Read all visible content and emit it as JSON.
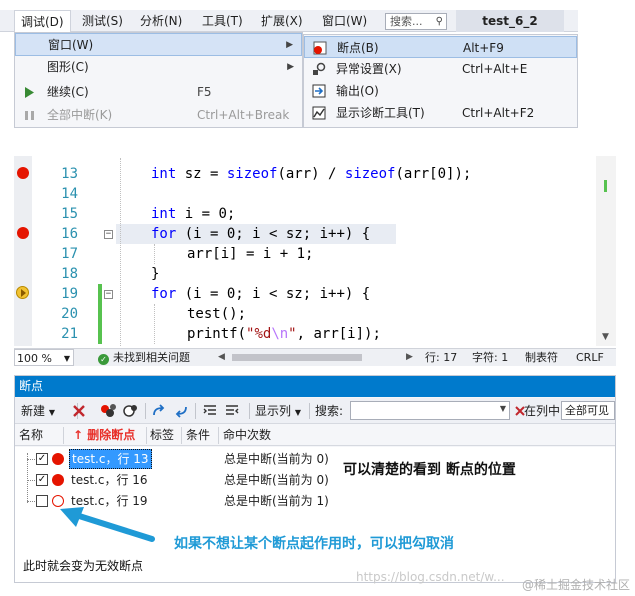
{
  "menubar": {
    "items": [
      "调试(D)",
      "测试(S)",
      "分析(N)",
      "工具(T)",
      "扩展(X)",
      "窗口(W)"
    ],
    "search_placeholder": "搜索...",
    "project_title": "test_6_2"
  },
  "debug_menu": {
    "items": [
      {
        "label": "窗口(W)",
        "shortcut": "",
        "submenu": true
      },
      {
        "label": "图形(C)",
        "shortcut": "",
        "submenu": true
      },
      {
        "label": "继续(C)",
        "shortcut": "F5"
      },
      {
        "label": "全部中断(K)",
        "shortcut": "Ctrl+Alt+Break"
      }
    ]
  },
  "windows_submenu": {
    "items": [
      {
        "label": "断点(B)",
        "shortcut": "Alt+F9"
      },
      {
        "label": "异常设置(X)",
        "shortcut": "Ctrl+Alt+E"
      },
      {
        "label": "输出(O)",
        "shortcut": ""
      },
      {
        "label": "显示诊断工具(T)",
        "shortcut": "Ctrl+Alt+F2"
      }
    ]
  },
  "editor": {
    "line_numbers": [
      "13",
      "14",
      "15",
      "16",
      "17",
      "18",
      "19",
      "20",
      "21"
    ],
    "zoom": "100 %",
    "issues": "未找到相关问题",
    "line_status": "行: 17",
    "char_status": "字符: 1",
    "tab_status": "制表符",
    "eol_status": "CRLF",
    "code": {
      "l13_type": "int",
      "l13_mid": " sz = ",
      "l13_fn1": "sizeof",
      "l13_args": "(arr) / ",
      "l13_fn2": "sizeof",
      "l13_end": "(arr[0]);",
      "l15_type": "int",
      "l15_rest": " i = 0;",
      "l16_kw": "for",
      "l16_rest": " (i = 0; i < sz; i++) {",
      "l17_text": "arr[i] = i + 1;",
      "l18_text": "}",
      "l19_kw": "for",
      "l19_rest": " (i = 0; i < sz; i++) {",
      "l20_text": "test();",
      "l21_fn": "printf(",
      "l21_str1": "\"%d",
      "l21_esc": "\\n",
      "l21_str2": "\"",
      "l21_end": ", arr[i]);"
    }
  },
  "breakpoints_window": {
    "title": "断点",
    "toolbar": {
      "new_label": "新建",
      "columns_label": "显示列",
      "search_label": "搜索:",
      "in_column_label": "在列中:",
      "scope_value": "全部可见"
    },
    "columns": {
      "name": "名称",
      "delete_note": "↑ 删除断点",
      "labels": "标签",
      "condition": "条件",
      "hit_count": "命中次数"
    },
    "rows": [
      {
        "checked": true,
        "enabled": true,
        "name": "test.c，行 13",
        "hit": "总是中断(当前为 0)"
      },
      {
        "checked": true,
        "enabled": true,
        "name": "test.c，行 16",
        "hit": "总是中断(当前为 0)"
      },
      {
        "checked": false,
        "enabled": false,
        "name": "test.c，行 19",
        "hit": "总是中断(当前为 1)"
      }
    ],
    "annotations": {
      "clear_view": "可以清楚的看到 断点的位置",
      "uncheck_tip": "如果不想让某个断点起作用时，可以把勾取消",
      "invalid_tip": "此时就会变为无效断点"
    }
  },
  "watermark": {
    "csdn": "https://blog.csdn.net/w...",
    "juejin": "@稀土掘金技术社区"
  },
  "colors": {
    "accent": "#007acc",
    "breakpoint": "#e51400",
    "annotation_blue": "#1f9ad6",
    "annotation_red": "#e8302a"
  }
}
